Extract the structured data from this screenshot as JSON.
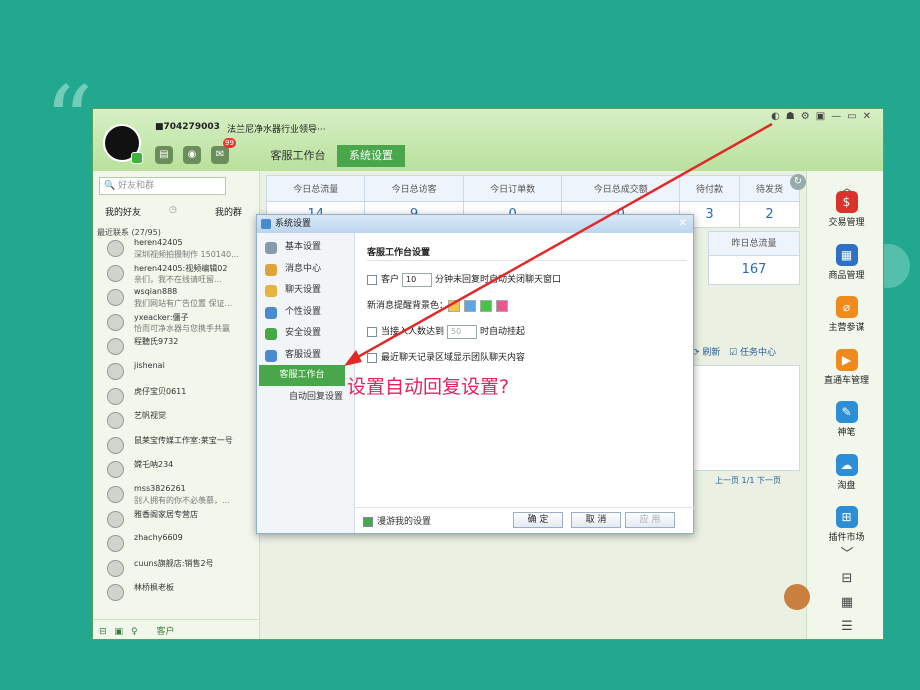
{
  "app": {
    "username": "■704279003",
    "signature": "法兰尼净水器行业领导···",
    "mail_badge": "99",
    "tabs": [
      "客服工作台",
      "系统设置"
    ],
    "active_tab": "系统设置"
  },
  "left": {
    "search_placeholder": "好友和群",
    "tabs": [
      "我的好友",
      "我的群"
    ],
    "group": "最近联系 (27/95)",
    "contacts": [
      {
        "name": "heren42405",
        "msg": "深圳视频拍摄制作 150140..."
      },
      {
        "name": "heren42405:视频编辑02",
        "msg": "亲们，我不在线请旺留..."
      },
      {
        "name": "wsqian888",
        "msg": "我们网站有广告位置 保证..."
      },
      {
        "name": "yxeacker:僵子",
        "msg": "恰而可净水器与您携手共赢"
      },
      {
        "name": "程聽氏9732",
        "msg": ""
      },
      {
        "name": "jishenai",
        "msg": ""
      },
      {
        "name": "虎仔宝贝0611",
        "msg": ""
      },
      {
        "name": "艺帆视觉",
        "msg": ""
      },
      {
        "name": "鼠莱宝传媒工作室:莱宝一号",
        "msg": ""
      },
      {
        "name": "嫦乇呐234",
        "msg": ""
      },
      {
        "name": "mss3826261",
        "msg": "别人拥有的你不必羡慕，..."
      },
      {
        "name": "雅香阁家居专营店",
        "msg": ""
      },
      {
        "name": "zhachy6609",
        "msg": ""
      },
      {
        "name": "cuuns旗舰店:销售2号",
        "msg": ""
      },
      {
        "name": "林桥枫老板",
        "msg": ""
      }
    ],
    "bottom_label": "客户"
  },
  "stats": {
    "headers": [
      "今日总流量",
      "今日总访客",
      "今日订单数",
      "今日总成交额",
      "待付款",
      "待发货"
    ],
    "values": [
      "14",
      "9",
      "0",
      "0",
      "3",
      "2"
    ],
    "extra_header": "昨日总流量",
    "extra_value": "167"
  },
  "toolbar": {
    "refresh": "刷新",
    "task_center": "任务中心",
    "paging": "上一页 1/1 下一页"
  },
  "right": {
    "items": [
      "交易管理",
      "商品管理",
      "主营参谋",
      "直通车管理",
      "神笔",
      "淘盘",
      "插件市场"
    ]
  },
  "dialog": {
    "title": "系统设置",
    "nav": [
      "基本设置",
      "消息中心",
      "聊天设置",
      "个性设置",
      "安全设置",
      "客服设置"
    ],
    "subnav": [
      "客服工作台",
      "自动回复设置"
    ],
    "section_title": "客服工作台设置",
    "opt1_pre": "客户",
    "opt1_value": "10",
    "opt1_post": "分钟未回复时自动关闭聊天窗口",
    "opt2": "新消息提醒背景色：",
    "opt3_pre": "当接入人数达到",
    "opt3_value": "50",
    "opt3_post": "时自动挂起",
    "opt4": "最近聊天记录区域显示团队聊天内容",
    "roam": "漫游我的设置",
    "ok": "确 定",
    "cancel": "取 消",
    "apply": "应 用",
    "swatches": [
      "#f5c64a",
      "#5aa6e6",
      "#45c445",
      "#e6588f"
    ]
  },
  "annotation": "设置自动回复设置?"
}
